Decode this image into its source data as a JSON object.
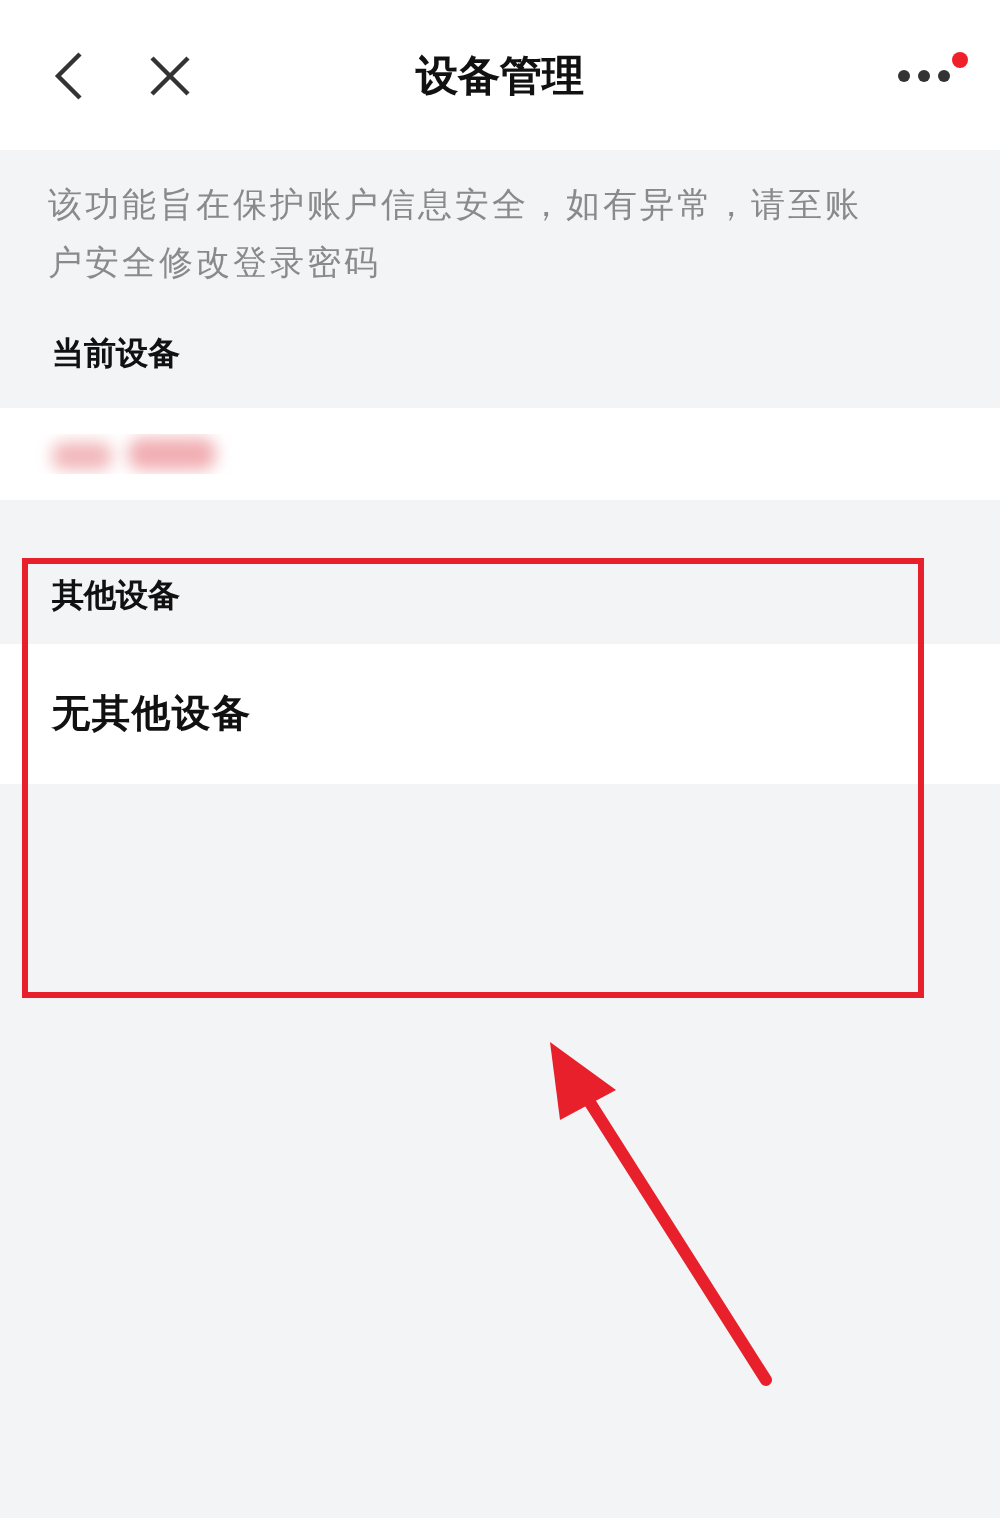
{
  "header": {
    "title": "设备管理",
    "more_badge": true
  },
  "notice": "该功能旨在保护账户信息安全，如有异常，请至账户安全修改登录密码",
  "sections": [
    {
      "title": "当前设备",
      "kind": "blurred"
    },
    {
      "title": "其他设备",
      "kind": "text",
      "text": "无其他设备"
    }
  ],
  "annotations": {
    "highlight_box": true,
    "arrow": true
  }
}
